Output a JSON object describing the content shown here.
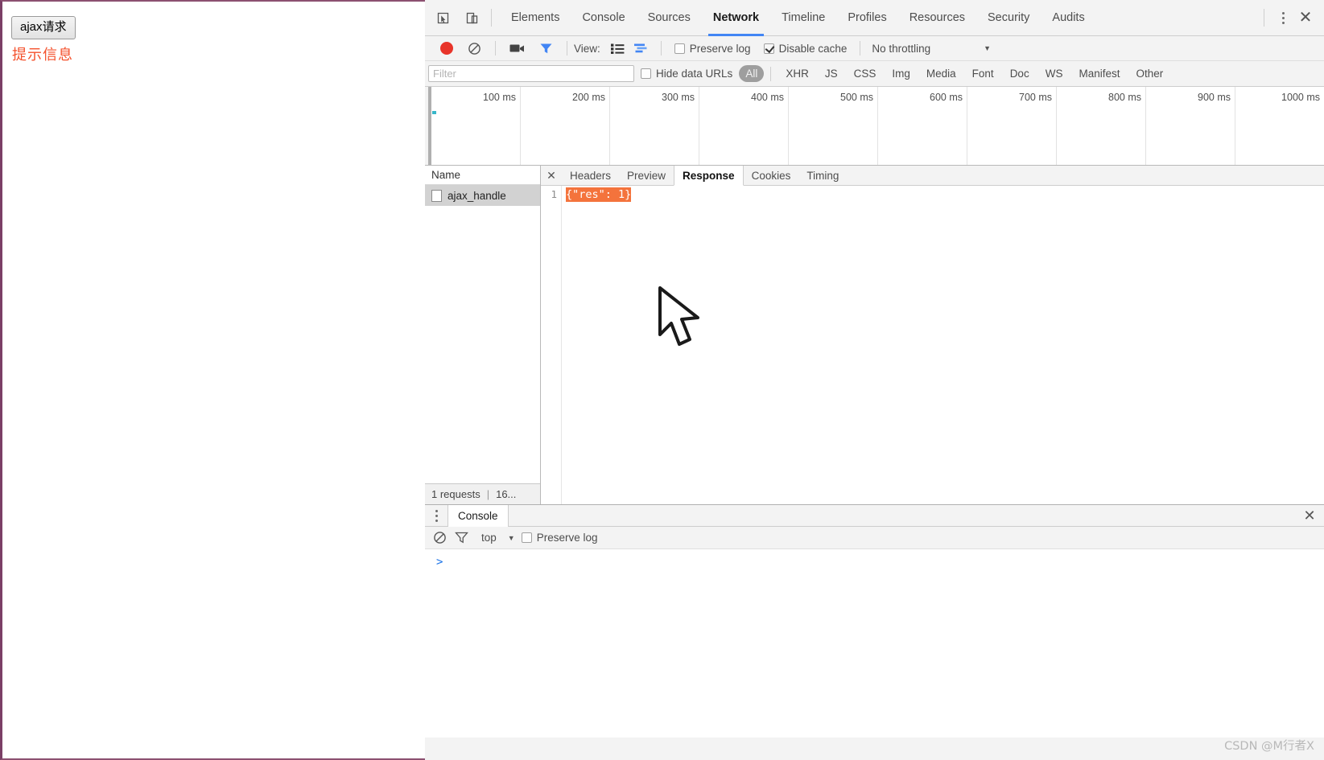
{
  "page": {
    "button_label": "ajax请求",
    "tip_text": "提示信息",
    "tip_color": "#f4512c",
    "border_color": "#7b3f66"
  },
  "devtools": {
    "icons": {
      "inspect": "inspect-element-icon",
      "device": "device-toolbar-icon",
      "more": "more-options-icon",
      "close": "close-devtools-icon"
    },
    "tabs": [
      {
        "label": "Elements",
        "active": false
      },
      {
        "label": "Console",
        "active": false
      },
      {
        "label": "Sources",
        "active": false
      },
      {
        "label": "Network",
        "active": true
      },
      {
        "label": "Timeline",
        "active": false
      },
      {
        "label": "Profiles",
        "active": false
      },
      {
        "label": "Resources",
        "active": false
      },
      {
        "label": "Security",
        "active": false
      },
      {
        "label": "Audits",
        "active": false
      }
    ],
    "accent_color": "#4285f4",
    "network_toolbar": {
      "record_icon": "record-button-icon",
      "record_color": "#e8342a",
      "clear_icon": "clear-icon",
      "capture_screenshots_icon": "camera-icon",
      "filter_icon": "filter-funnel-icon",
      "filter_icon_color": "#4285f4",
      "view_label": "View:",
      "view_list_icon": "list-view-icon",
      "view_waterfall_icon": "waterfall-view-icon",
      "preserve_log_label": "Preserve log",
      "preserve_log_checked": false,
      "disable_cache_label": "Disable cache",
      "disable_cache_checked": true,
      "throttling_value": "No throttling",
      "throttling_arrow": "▼"
    },
    "filter_bar": {
      "input_value": "",
      "input_placeholder": "Filter",
      "hide_data_urls_label": "Hide data URLs",
      "hide_data_urls_checked": false,
      "types": [
        "All",
        "XHR",
        "JS",
        "CSS",
        "Img",
        "Media",
        "Font",
        "Doc",
        "WS",
        "Manifest",
        "Other"
      ],
      "selected_type": "All"
    },
    "overview": {
      "ticks": [
        "100 ms",
        "200 ms",
        "300 ms",
        "400 ms",
        "500 ms",
        "600 ms",
        "700 ms",
        "800 ms",
        "900 ms",
        "1000 ms"
      ],
      "marker_color": "#37b6c9"
    },
    "request_list": {
      "column_header": "Name",
      "rows": [
        {
          "name": "ajax_handle",
          "icon": "document-icon",
          "selected": true
        }
      ],
      "status_requests": "1 requests",
      "status_separator": "|",
      "status_transferred": "16..."
    },
    "detail_panel": {
      "close_icon": "close-detail-icon",
      "tabs": [
        {
          "label": "Headers",
          "active": false
        },
        {
          "label": "Preview",
          "active": false
        },
        {
          "label": "Response",
          "active": true
        },
        {
          "label": "Cookies",
          "active": false
        },
        {
          "label": "Timing",
          "active": false
        }
      ],
      "response": {
        "line_number": "1",
        "body": "{\"res\": 1}",
        "selection_color": "#f4733c",
        "selection_text_color": "#ffffff"
      }
    },
    "drawer": {
      "more_icon": "more-options-icon",
      "tab_label": "Console",
      "close_icon": "close-drawer-icon",
      "clear_icon": "clear-console-icon",
      "filter_icon": "filter-funnel-icon",
      "context_value": "top",
      "context_arrow": "▼",
      "preserve_log_label": "Preserve log",
      "preserve_log_checked": false,
      "prompt_symbol": ">",
      "prompt_color": "#1a73e8"
    }
  },
  "watermark": "CSDN @M行者X"
}
